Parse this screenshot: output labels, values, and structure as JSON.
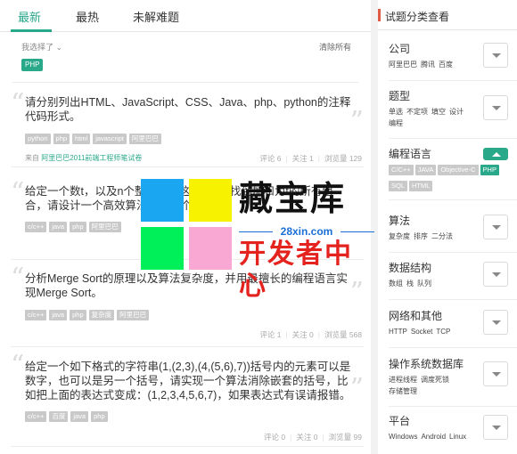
{
  "tabs": [
    "最新",
    "最热",
    "未解难题"
  ],
  "filter": {
    "label": "我选择了",
    "clear": "清除所有",
    "tag": "PHP"
  },
  "questions": [
    {
      "text": "请分别列出HTML、JavaScript、CSS、Java、php、python的注释代码形式。",
      "tags": [
        "python",
        "php",
        "html",
        "javascript",
        "阿里巴巴"
      ],
      "source_prefix": "来自",
      "source": "阿里巴巴2011前端工程师笔试卷",
      "comments": "评论 6",
      "follows": "关注 1",
      "views": "浏览量 129"
    },
    {
      "text": "给定一个数t，以及n个整数，在这n个数中找到加和为t的所有组合，请设计一个高效算法实现这个需求。",
      "tags": [
        "c/c++",
        "java",
        "php",
        "阿里巴巴"
      ],
      "source_prefix": "",
      "source": "",
      "comments": "",
      "follows": "",
      "views": ""
    },
    {
      "text": "分析Merge Sort的原理以及算法复杂度，并用最擅长的编程语言实现Merge Sort。",
      "tags": [
        "c/c++",
        "java",
        "php",
        "复杂度",
        "阿里巴巴"
      ],
      "source_prefix": "",
      "source": "",
      "comments": "评论 1",
      "follows": "关注 0",
      "views": "浏览量 568"
    },
    {
      "text": "给定一个如下格式的字符串(1,(2,3),(4,(5,6),7))括号内的元素可以是数字，也可以是另一个括号，请实现一个算法消除嵌套的括号，比如把上面的表达式变成：(1,2,3,4,5,6,7)，如果表达式有误请报错。",
      "tags": [
        "c/c++",
        "百度",
        "java",
        "php"
      ],
      "source_prefix": "",
      "source": "",
      "comments": "评论 0",
      "follows": "关注 0",
      "views": "浏览量 99"
    }
  ],
  "sidebar": {
    "title": "试题分类查看",
    "categories": [
      {
        "title": "公司",
        "items": [
          "阿里巴巴",
          "腾讯",
          "百度"
        ]
      },
      {
        "title": "题型",
        "items": [
          "单选",
          "不定项",
          "填空",
          "设计",
          "编程"
        ]
      },
      {
        "title": "编程语言",
        "tags": [
          "C/C++",
          "JAVA",
          "Objective-C",
          "PHP",
          "SQL",
          "HTML"
        ],
        "active_tag": "PHP"
      },
      {
        "title": "算法",
        "items": [
          "复杂度",
          "排序",
          "二分法"
        ]
      },
      {
        "title": "数据结构",
        "items": [
          "数组",
          "栈",
          "队列"
        ]
      },
      {
        "title": "网络和其他",
        "items": [
          "HTTP",
          "Socket",
          "TCP"
        ]
      },
      {
        "title": "操作系统数据库",
        "items": [
          "进程线程",
          "调度死锁",
          "存储管理"
        ]
      },
      {
        "title": "平台",
        "items": [
          "Windows",
          "Android",
          "Linux"
        ]
      }
    ]
  },
  "watermark": {
    "title": "藏宝库",
    "url": "28xin.com",
    "subtitle": "开发者中心"
  },
  "colors": {
    "accent": "#2aa88a",
    "sidebar_accent": "#e05b45",
    "tag_gray": "#c9c9c9"
  }
}
